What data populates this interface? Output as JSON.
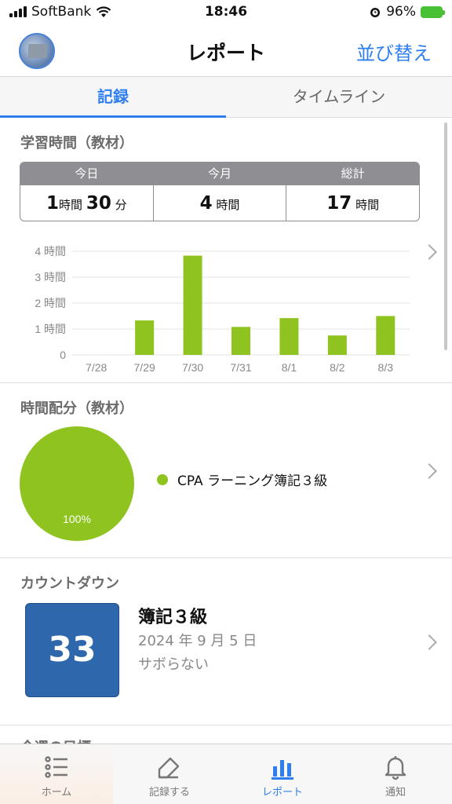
{
  "status": {
    "carrier": "SoftBank",
    "time": "18:46",
    "battery": "96%"
  },
  "header": {
    "title": "レポート",
    "sort_label": "並び替え"
  },
  "tabs": [
    {
      "label": "記録"
    },
    {
      "label": "タイムライン"
    }
  ],
  "study_time": {
    "title": "学習時間（教材）",
    "summary": {
      "today": {
        "label": "今日",
        "h": "1",
        "h_unit": "時間",
        "m": "30",
        "m_unit": "分"
      },
      "month": {
        "label": "今月",
        "h": "4",
        "h_unit": "時間"
      },
      "total": {
        "label": "総計",
        "h": "17",
        "h_unit": "時間"
      }
    }
  },
  "chart_data": {
    "type": "bar",
    "categories": [
      "7/28",
      "7/29",
      "7/30",
      "7/31",
      "8/1",
      "8/2",
      "8/3"
    ],
    "values": [
      0,
      1.33,
      3.83,
      1.08,
      1.42,
      0.75,
      1.5
    ],
    "ylim": [
      0,
      4
    ],
    "yticks": [
      "0",
      "1 時間",
      "2 時間",
      "3 時間",
      "4 時間"
    ],
    "grid": true,
    "color": "#8fc31f"
  },
  "distribution": {
    "title": "時間配分（教材）",
    "pie": [
      {
        "name": "CPA ラーニング簿記３級",
        "percent": 100,
        "label": "100%",
        "color": "#8fc31f"
      }
    ]
  },
  "countdown": {
    "title": "カウントダウン",
    "days": "33",
    "name": "簿記３級",
    "date": "2024 年 9 月 5 日",
    "note": "サボらない"
  },
  "next_section": "今週の目標",
  "tabbar": [
    {
      "label": "ホーム",
      "icon": "list-icon"
    },
    {
      "label": "記録する",
      "icon": "pencil-icon"
    },
    {
      "label": "レポート",
      "icon": "bar-chart-icon"
    },
    {
      "label": "通知",
      "icon": "bell-icon"
    }
  ]
}
